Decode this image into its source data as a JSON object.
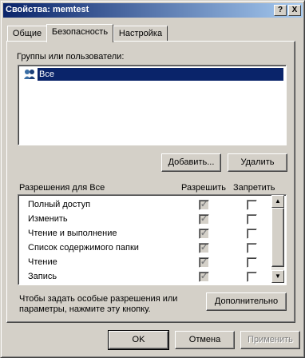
{
  "window": {
    "title": "Свойства: memtest"
  },
  "title_buttons": {
    "help": "?",
    "close": "X"
  },
  "tabs": [
    {
      "label": "Общие",
      "active": false
    },
    {
      "label": "Безопасность",
      "active": true
    },
    {
      "label": "Настройка",
      "active": false
    }
  ],
  "groups": {
    "label": "Группы или пользователи:",
    "items": [
      {
        "name": "Все",
        "selected": true
      }
    ],
    "add_button": "Добавить...",
    "remove_button": "Удалить"
  },
  "permissions": {
    "label": "Разрешения для Все",
    "col_allow": "Разрешить",
    "col_deny": "Запретить",
    "rows": [
      {
        "name": "Полный доступ",
        "allow": true,
        "deny": false
      },
      {
        "name": "Изменить",
        "allow": true,
        "deny": false
      },
      {
        "name": "Чтение и выполнение",
        "allow": true,
        "deny": false
      },
      {
        "name": "Список содержимого папки",
        "allow": true,
        "deny": false
      },
      {
        "name": "Чтение",
        "allow": true,
        "deny": false
      },
      {
        "name": "Запись",
        "allow": true,
        "deny": false
      }
    ]
  },
  "advanced": {
    "text_line1": "Чтобы задать особые разрешения или",
    "text_line2": "параметры, нажмите эту кнопку.",
    "button": "Дополнительно"
  },
  "footer": {
    "ok": "OK",
    "cancel": "Отмена",
    "apply": "Применить"
  },
  "colors": {
    "selection": "#0a246a",
    "face": "#d4d0c8",
    "title_start": "#0a246a",
    "title_end": "#a6caf0"
  }
}
